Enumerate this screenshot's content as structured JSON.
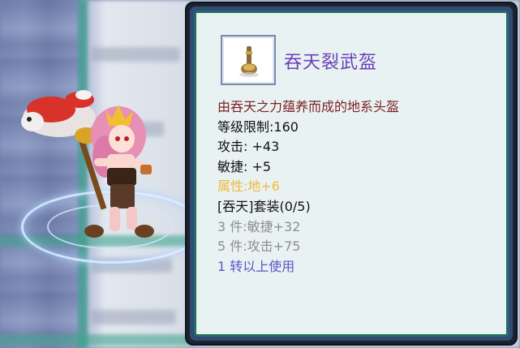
{
  "item": {
    "name": "吞天裂武盔",
    "icon": "helmet-icon",
    "lines": [
      {
        "text": "由吞天之力蕴养而成的地系头盔",
        "color": "#7a1f1f"
      },
      {
        "text": "等级限制:160",
        "color": "#111111"
      },
      {
        "text": "攻击: +43",
        "color": "#111111"
      },
      {
        "text": "敏捷: +5",
        "color": "#111111"
      },
      {
        "text": "属性:地+6",
        "color": "#f0b93a"
      },
      {
        "text": "[吞天]套装(0/5)",
        "color": "#111111"
      },
      {
        "text": "3 件:敏捷+32",
        "color": "#8e8e8e"
      },
      {
        "text": "5 件:攻击+75",
        "color": "#8e8e8e"
      },
      {
        "text": "1 转以上使用",
        "color": "#5a56c8"
      }
    ]
  },
  "colors": {
    "panel_border": "#334a76",
    "panel_bg": "#e9f2f3",
    "panel_inner_border": "#1f6f62",
    "item_name": "#6a3fb8"
  }
}
